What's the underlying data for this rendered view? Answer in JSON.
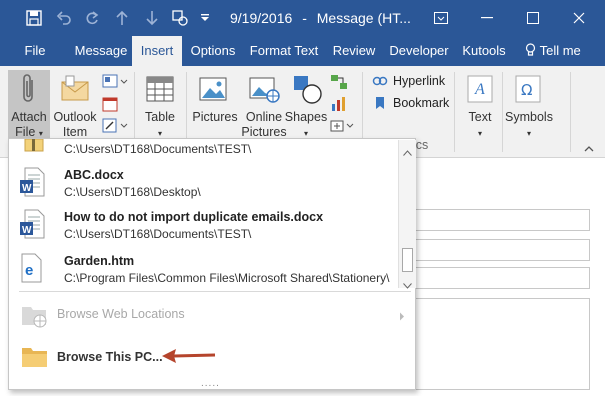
{
  "titlebar": {
    "date": "9/19/2016",
    "separator": "-",
    "window_title": "Message (HT...",
    "window_buttons": [
      "ribbon-options-icon",
      "minimize-icon",
      "maximize-icon",
      "close-icon"
    ]
  },
  "tabs": {
    "file": "File",
    "message": "Message",
    "insert": "Insert",
    "options": "Options",
    "format_text": "Format Text",
    "review": "Review",
    "developer": "Developer",
    "kutools": "Kutools",
    "tell_me": "Tell me"
  },
  "ribbon": {
    "attach_file_line1": "Attach",
    "attach_file_line2": "File",
    "outlook_item_line1": "Outlook",
    "outlook_item_line2": "Item",
    "table": "Table",
    "pictures": "Pictures",
    "online_pictures_line1": "Online",
    "online_pictures_line2": "Pictures",
    "shapes": "Shapes",
    "hyperlink": "Hyperlink",
    "bookmark": "Bookmark",
    "text": "Text",
    "symbols": "Symbols",
    "group_label_fragment": "cs"
  },
  "menu": {
    "recent": [
      {
        "title": "",
        "path": "C:\\Users\\DT168\\Documents\\TEST\\",
        "icon": "folder-zip-icon"
      },
      {
        "title": "ABC.docx",
        "path": "C:\\Users\\DT168\\Desktop\\",
        "icon": "word-doc-icon"
      },
      {
        "title": "How to do not import duplicate emails.docx",
        "path": "C:\\Users\\DT168\\Documents\\TEST\\",
        "icon": "word-doc-icon"
      },
      {
        "title": "Garden.htm",
        "path": "C:\\Program Files\\Common Files\\Microsoft Shared\\Stationery\\",
        "icon": "edge-html-icon"
      }
    ],
    "browse_web": "Browse Web Locations",
    "browse_pc": "Browse This PC...",
    "grip": "....."
  },
  "colors": {
    "title_bar": "#2b5797",
    "ribbon_bg": "#f1f1f1",
    "arrow": "#b5442c",
    "word_blue": "#2b579a"
  }
}
